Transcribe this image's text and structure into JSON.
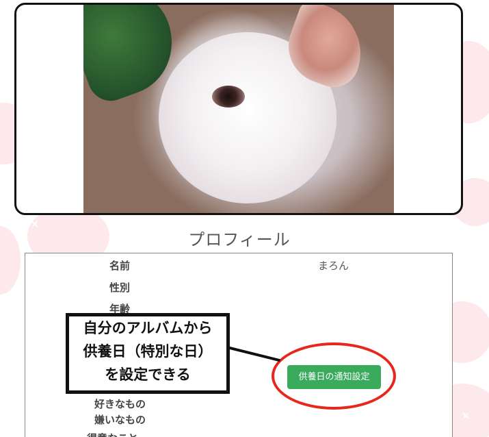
{
  "section_title": "プロフィール",
  "profile": {
    "rows": [
      {
        "label": "名前",
        "value": "まろん"
      },
      {
        "label": "性別",
        "value": ""
      },
      {
        "label": "年齢",
        "value": ""
      },
      {
        "label": "好きなもの",
        "value": ""
      },
      {
        "label": "嫌いなもの",
        "value": ""
      },
      {
        "label": "得意なこと",
        "value": ""
      }
    ]
  },
  "notify_button_label": "供養日の通知設定",
  "callout": {
    "lines": [
      "自分のアルバムから",
      "供養日（特別な日）",
      "を設定できる"
    ]
  },
  "colors": {
    "button_green": "#3aaa5c",
    "highlight_red": "#e8271c",
    "background_blob": "#fabec8"
  }
}
